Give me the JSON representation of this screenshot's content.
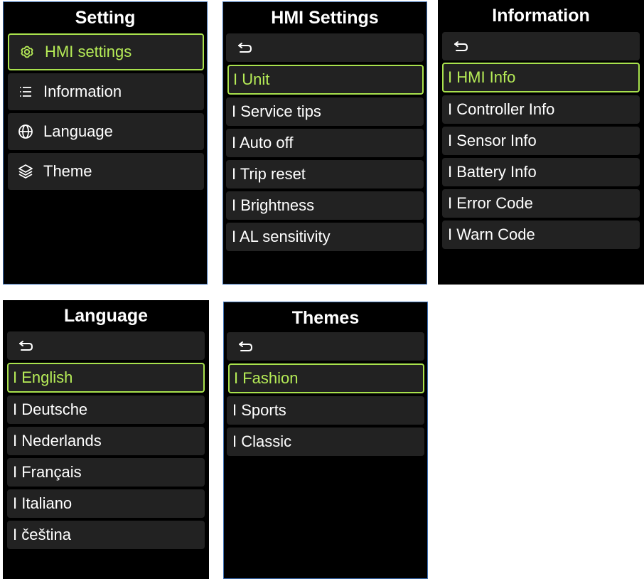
{
  "colors": {
    "accent": "#b6ec57",
    "item_bg": "#222222",
    "screen_bg": "#000000",
    "frame": "#3c6fb3"
  },
  "setting": {
    "title": "Setting",
    "items": [
      {
        "icon": "gear-icon",
        "label": "HMI settings",
        "selected": true
      },
      {
        "icon": "list-icon",
        "label": "Information"
      },
      {
        "icon": "globe-icon",
        "label": "Language"
      },
      {
        "icon": "layers-icon",
        "label": "Theme"
      }
    ]
  },
  "hmi": {
    "title": "HMI Settings",
    "back_icon": "back-arrow-icon",
    "items": [
      "I Unit",
      "I Service tips",
      "I Auto off",
      "I Trip reset",
      "I Brightness",
      "I AL sensitivity"
    ],
    "selected_index": 0
  },
  "information": {
    "title": "Information",
    "back_icon": "back-arrow-icon",
    "items": [
      "I HMI Info",
      "I Controller Info",
      "I Sensor Info",
      "I Battery Info",
      "I Error Code",
      "I Warn Code"
    ],
    "selected_index": 0
  },
  "language": {
    "title": "Language",
    "back_icon": "back-arrow-icon",
    "items": [
      "I English",
      "I Deutsche",
      "I Nederlands",
      "I Français",
      "I Italiano",
      "I čeština"
    ],
    "selected_index": 0
  },
  "themes": {
    "title": "Themes",
    "back_icon": "back-arrow-icon",
    "items": [
      "I Fashion",
      "I Sports",
      "I Classic"
    ],
    "selected_index": 0
  }
}
